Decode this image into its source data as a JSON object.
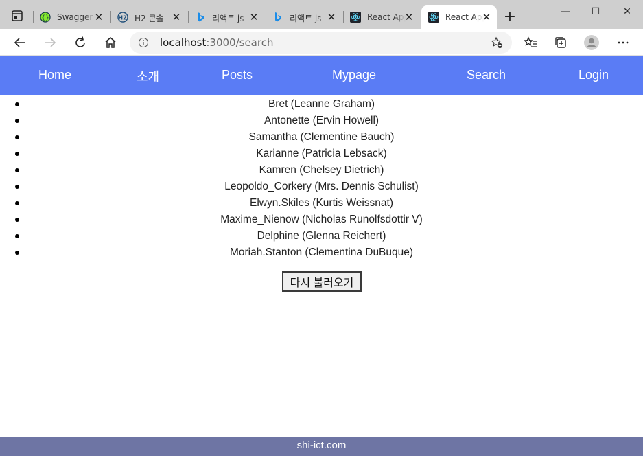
{
  "browser": {
    "tabs": [
      {
        "title": "Swagger",
        "icon": "swagger-icon"
      },
      {
        "title": "H2 콘솔",
        "icon": "h2-icon"
      },
      {
        "title": "리액트 js",
        "icon": "bing-icon"
      },
      {
        "title": "리액트 js",
        "icon": "bing-icon"
      },
      {
        "title": "React App",
        "icon": "react-icon"
      },
      {
        "title": "React App",
        "icon": "react-icon",
        "active": true
      }
    ],
    "address": {
      "host": "localhost",
      "path": ":3000/search"
    },
    "window_controls": {
      "minimize": "—",
      "maximize": "☐",
      "close": "✕"
    },
    "new_tab": "+"
  },
  "nav": {
    "home": "Home",
    "intro": "소개",
    "posts": "Posts",
    "mypage": "Mypage",
    "search": "Search",
    "login": "Login"
  },
  "users": [
    "Bret (Leanne Graham)",
    "Antonette (Ervin Howell)",
    "Samantha (Clementine Bauch)",
    "Karianne (Patricia Lebsack)",
    "Kamren (Chelsey Dietrich)",
    "Leopoldo_Corkery (Mrs. Dennis Schulist)",
    "Elwyn.Skiles (Kurtis Weissnat)",
    "Maxime_Nienow (Nicholas Runolfsdottir V)",
    "Delphine (Glenna Reichert)",
    "Moriah.Stanton (Clementina DuBuque)"
  ],
  "reload_button": "다시 불러오기",
  "footer": "shi-ict.com",
  "colors": {
    "nav_bg": "#5a7cf5",
    "footer_bg": "#6e75a4",
    "tabbar_bg": "#cfcfcf"
  }
}
